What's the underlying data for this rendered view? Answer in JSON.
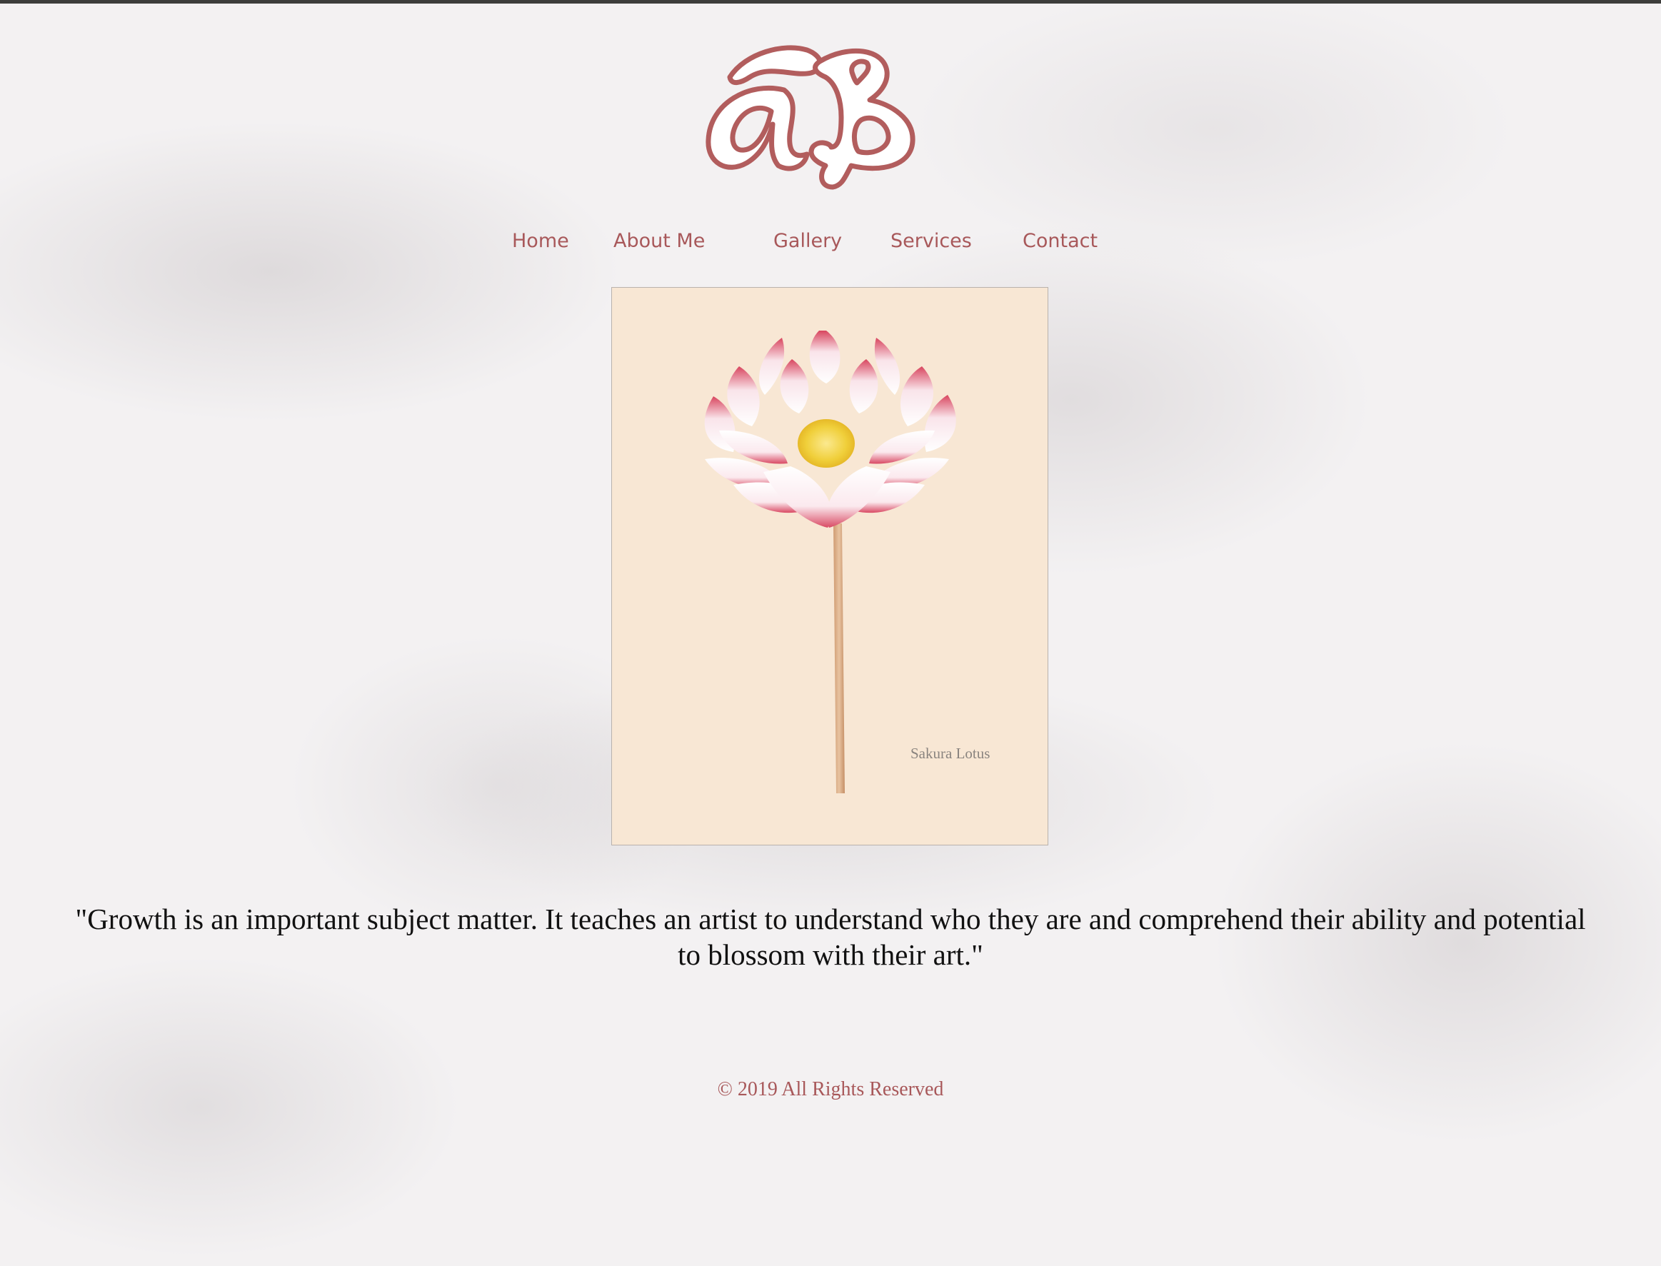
{
  "brand": {
    "logo_text": "aB",
    "logo_color": "#b25d5d"
  },
  "nav": {
    "items": [
      {
        "label": "Home"
      },
      {
        "label": "About Me"
      },
      {
        "label": "Gallery"
      },
      {
        "label": "Services"
      },
      {
        "label": "Contact"
      }
    ],
    "color": "#a8585a"
  },
  "artwork": {
    "caption": "Sakura Lotus",
    "background_color": "#f8e7d4"
  },
  "quote": {
    "text": "\"Growth is an important subject matter. It teaches an artist to understand who they are and comprehend their ability and potential to blossom with their art.\""
  },
  "footer": {
    "text": "© 2019 All Rights Reserved"
  }
}
